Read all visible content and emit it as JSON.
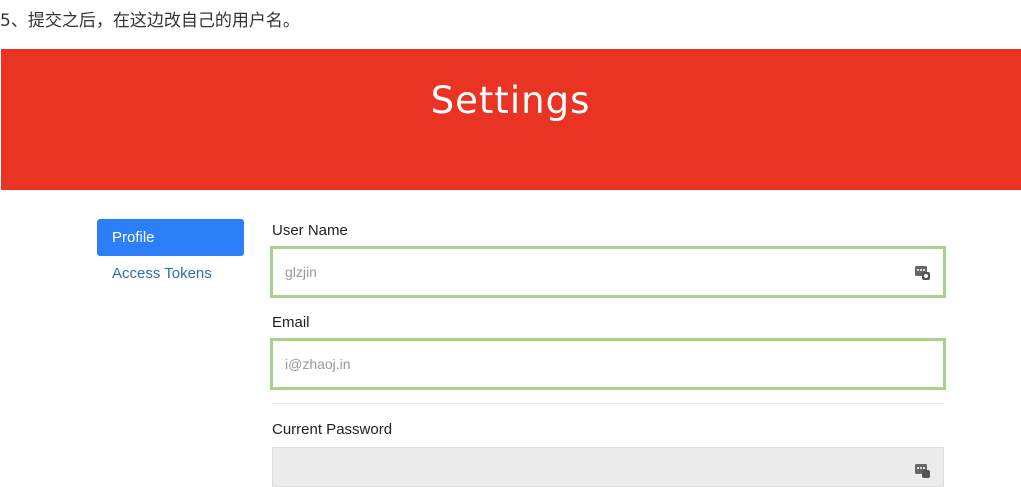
{
  "caption": "5、提交之后，在这边改自己的用户名。",
  "header": {
    "title": "Settings",
    "background_color": "#e93323"
  },
  "sidebar": {
    "items": [
      {
        "label": "Profile",
        "active": true
      },
      {
        "label": "Access Tokens",
        "active": false
      }
    ],
    "active_color": "#2d7ff9",
    "link_color": "#2d6fb3"
  },
  "form": {
    "username": {
      "label": "User Name",
      "placeholder": "glzjin",
      "icon": "password-manager-key-icon"
    },
    "email": {
      "label": "Email",
      "placeholder": "i@zhaoj.in"
    },
    "current_password": {
      "label": "Current Password",
      "value": "",
      "icon": "password-manager-key-icon"
    },
    "highlight_color": "#a8d38e"
  }
}
